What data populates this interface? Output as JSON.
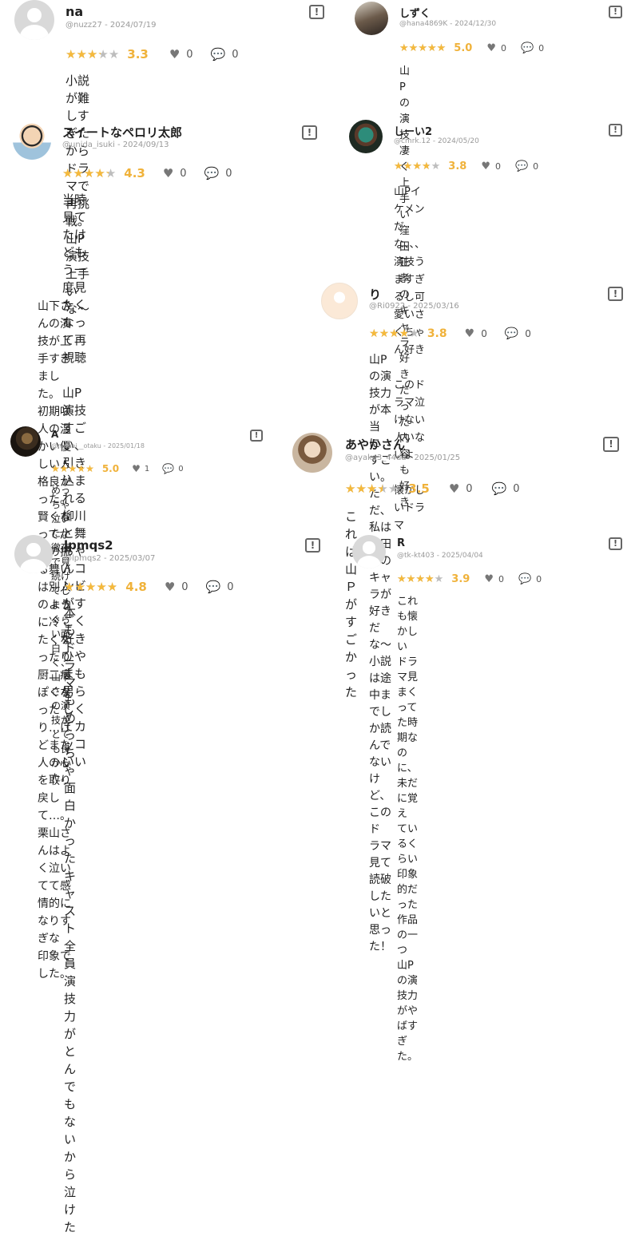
{
  "colors": {
    "star_filled": "#f5b93c",
    "star_empty": "#bdbdbd",
    "score": "#f0b23a",
    "meta": "#9a9a9a"
  },
  "icons": {
    "like": "heart-icon",
    "comment": "comment-icon",
    "report": "report-icon"
  },
  "reviews": [
    {
      "name": "na",
      "handle": "@nuzz27",
      "date": "2024/07/19",
      "score": "3.3",
      "rating": 3.3,
      "likes": "0",
      "comments": "0",
      "text": "小説が難しすぎたからドラマで再挑戦。\n山P演技上手いな〜"
    },
    {
      "name": "しずく",
      "handle": "@hana4869K",
      "date": "2024/12/30",
      "score": "5.0",
      "rating": 5.0,
      "likes": "0",
      "comments": "0",
      "text": "山Pの演技凄く上手い\n窪田正孝のキャラ好きだった\n内容も好き"
    },
    {
      "name": "スイートなペロリ太郎",
      "handle": "@unida_isuki",
      "date": "2024/09/13",
      "score": "4.3",
      "rating": 4.3,
      "likes": "0",
      "comments": "0",
      "text": "当時見てたけどもう一度見たくなって再視聴\n\n山P演技すごい、引き込まれる\n柳川と舞ちゃんコンビがすごく好き\nひやまも男らしくてカッコいい"
    },
    {
      "name": "しーい2",
      "handle": "@cmrk.12",
      "date": "2024/05/20",
      "score": "3.8",
      "rating": 3.8,
      "likes": "0",
      "comments": "0",
      "text": "山Pイケメンだな、、、\n演技うますぎるし可愛いさくちゃん好き\n\nこのドラマ泣けない人いないよ\n\n懐かしいドラマ"
    },
    {
      "name": "",
      "handle": "",
      "date": "",
      "score": "",
      "rating": null,
      "likes": "",
      "comments": "",
      "text": "山下さんの演技が上手すぎました。\n初期咲人の温かい優しい人格良かった。\n賢くなってからの振る舞いは別人のように冷\nたくなったり厨二病ぽくなったり…けどまた\n人の心を取り戻して…。\n栗山さんはよく泣いてて感情的になりすぎな\n印象でした。"
    },
    {
      "name": "り",
      "handle": "@Ri0922",
      "date": "2025/03/16",
      "score": "3.8",
      "rating": 3.8,
      "likes": "0",
      "comments": "0",
      "text": "山Pの演技力が本当にすごい。\nただ、私は窪田君のキャラが好きだな〜\n小説は途中までしか読んでないけど、このド\nラマ見て読破したいと思った！"
    },
    {
      "name": "A",
      "handle": "@mukai__otaku",
      "date": "2025/01/18",
      "score": "5.0",
      "rating": 5.0,
      "likes": "1",
      "comments": "0",
      "text": "めっちゃ泣いた。徹夜で見続けてしまうぐら\nい面白く、山下さんの演技がとても良かっ\nた。"
    },
    {
      "name": "あやかさん",
      "handle": "@ayaka3_44da",
      "date": "2025/01/25",
      "score": "3.5",
      "rating": 3.5,
      "likes": "0",
      "comments": "0",
      "text": "これは山Ｐがすごかった"
    },
    {
      "name": "lpmqs2",
      "handle": "@lpmqs2",
      "date": "2025/03/07",
      "score": "4.8",
      "rating": 4.8,
      "likes": "0",
      "comments": "0",
      "text": "本もドラマもめっちゃ面白かった\nキャスト全員演技力がとんでもないから泣け\nた"
    },
    {
      "name": "R",
      "handle": "@tk-kt403",
      "date": "2025/04/04",
      "score": "3.9",
      "rating": 3.9,
      "likes": "0",
      "comments": "0",
      "text": "これも懐かしい\nドラマ見まくってた時期なのに、未だに覚え\nているくらい印象的だった作品の一つ\n山Pの演技力がやばすぎた。"
    }
  ]
}
